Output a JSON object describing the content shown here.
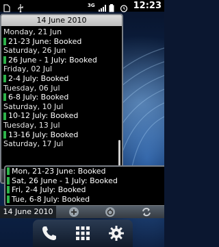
{
  "status_bar": {
    "time": "12:23",
    "network": "3G",
    "icons": [
      "sim-card-icon",
      "usb-icon",
      "signal-icon",
      "battery-icon",
      "alarm-icon"
    ]
  },
  "widget1": {
    "header_date": "14 June 2010",
    "items": [
      {
        "type": "day",
        "text": "Monday, 21 Jun"
      },
      {
        "type": "booking",
        "text": "21-23 June: Booked"
      },
      {
        "type": "day",
        "text": "Saturday, 26 Jun"
      },
      {
        "type": "booking",
        "text": "26 June - 1 July: Booked"
      },
      {
        "type": "day",
        "text": "Friday, 02 Jul"
      },
      {
        "type": "booking",
        "text": "2-4 July: Booked"
      },
      {
        "type": "day",
        "text": "Tuesday, 06 Jul"
      },
      {
        "type": "booking",
        "text": "6-8 July: Booked"
      },
      {
        "type": "day",
        "text": "Saturday, 10 Jul"
      },
      {
        "type": "booking",
        "text": "10-12 July: Booked"
      },
      {
        "type": "day",
        "text": "Tuesday, 13 Jul"
      },
      {
        "type": "booking",
        "text": "13-16 July: Booked"
      },
      {
        "type": "day",
        "text": "Saturday, 17 Jul"
      }
    ],
    "footer_icons": [
      "add-icon",
      "reset-icon",
      "refresh-icon"
    ]
  },
  "widget2": {
    "items": [
      "Mon, 21-23 June: Booked",
      "Sat, 26 June - 1 July: Booked",
      "Fri, 2-4 July: Booked",
      "Tue, 6-8 July: Booked"
    ],
    "footer_date": "14 June 2010",
    "footer_icons": [
      "add-icon",
      "reset-icon",
      "refresh-icon"
    ]
  },
  "dock": {
    "icons": [
      "phone-icon",
      "app-drawer-icon",
      "settings-icon"
    ]
  },
  "colors": {
    "booking_bar": "#2db34a",
    "header_bg": "#cfcfcf",
    "status_bar_bg": "#000000"
  }
}
